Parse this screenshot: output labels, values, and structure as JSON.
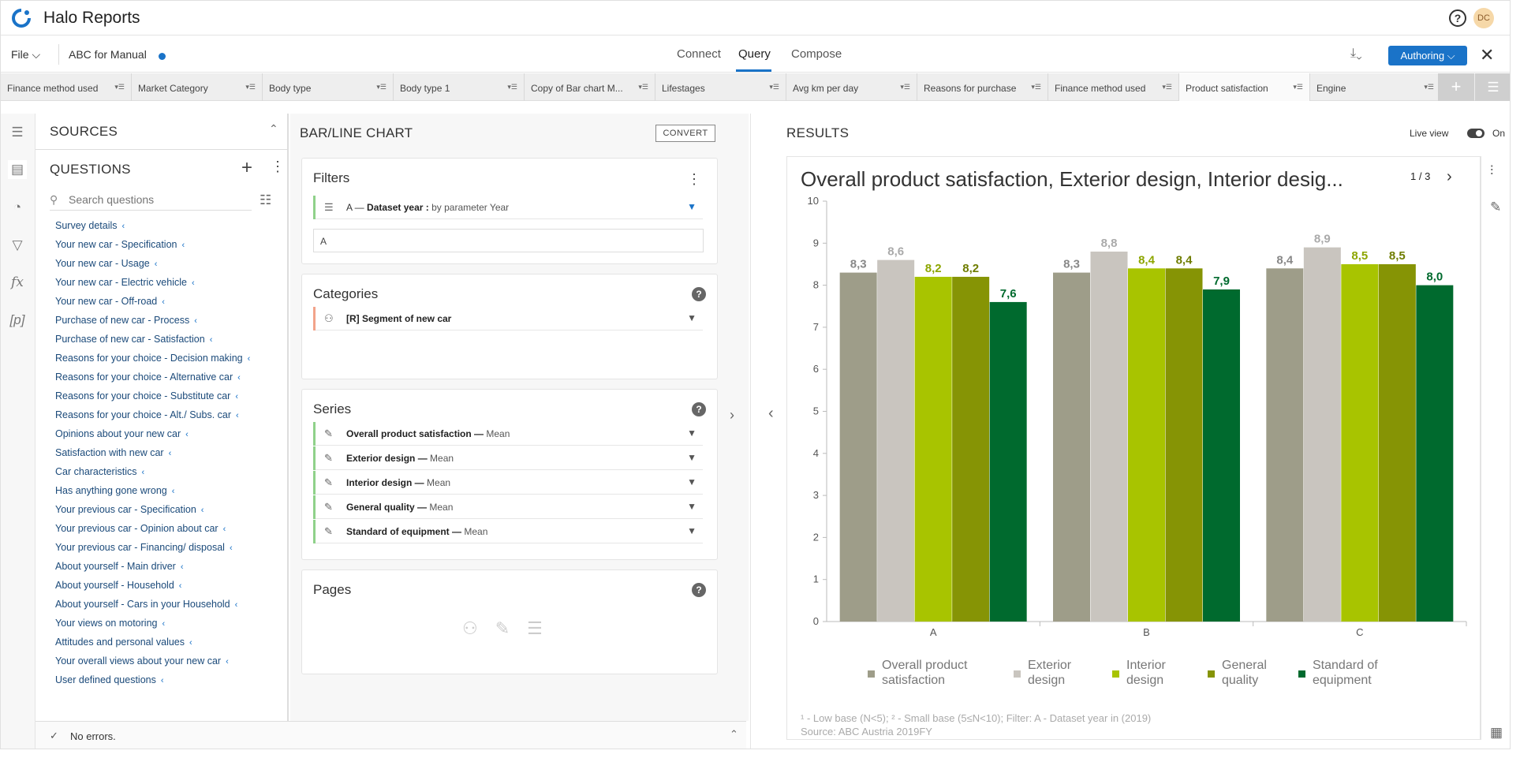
{
  "app": {
    "title": "Halo Reports",
    "avatar_initials": "DC",
    "help": "?"
  },
  "menubar": {
    "file": "File ⌵",
    "report_name": "ABC for Manual",
    "tabs": [
      "Connect",
      "Query",
      "Compose"
    ],
    "active_tab": "Query",
    "authoring": "Authoring ⌵",
    "close": "✕"
  },
  "question_tabs": [
    "Finance method used",
    "Market Category",
    "Body type",
    "Body type 1",
    "Copy of Bar chart M...",
    "Lifestages",
    "Avg km per day",
    "Reasons for purchase",
    "Finance method used",
    "Product satisfaction",
    "Engine"
  ],
  "active_question_tab": "Product satisfaction",
  "left_panel": {
    "sources_header": "SOURCES",
    "questions_header": "QUESTIONS",
    "search_placeholder": "Search questions",
    "questions": [
      "Survey details",
      "Your new car - Specification",
      "Your new car - Usage",
      "Your new car - Electric vehicle",
      "Your new car - Off-road",
      "Purchase of new car - Process",
      "Purchase of new car - Satisfaction",
      "Reasons for your choice - Decision making",
      "Reasons for your choice - Alternative car",
      "Reasons for your choice - Substitute car",
      "Reasons for your choice - Alt./ Subs. car",
      "Opinions about your new car",
      "Satisfaction with new car",
      "Car characteristics",
      "Has anything gone wrong",
      "Your previous car - Specification",
      "Your previous car - Opinion about car",
      "Your previous car - Financing/ disposal",
      "About yourself - Main driver",
      "About yourself - Household",
      "About yourself - Cars in your Household",
      "Your views on motoring",
      "Attitudes and personal values",
      "Your overall views about your new car",
      "User defined questions"
    ],
    "status": "No errors."
  },
  "middle_panel": {
    "title": "BAR/LINE CHART",
    "convert": "CONVERT",
    "filters": {
      "title": "Filters",
      "row_prefix": "A  —",
      "row_label": "Dataset year :",
      "row_suffix": "by parameter Year",
      "input_value": "A"
    },
    "categories": {
      "title": "Categories",
      "row": "[R] Segment of new car"
    },
    "series": {
      "title": "Series",
      "rows": [
        {
          "name": "Overall product satisfaction —",
          "measure": "Mean"
        },
        {
          "name": "Exterior design —",
          "measure": "Mean"
        },
        {
          "name": "Interior design —",
          "measure": "Mean"
        },
        {
          "name": "General quality —",
          "measure": "Mean"
        },
        {
          "name": "Standard of equipment —",
          "measure": "Mean"
        }
      ]
    },
    "pages": {
      "title": "Pages"
    }
  },
  "results": {
    "header": "RESULTS",
    "live_view": "Live view",
    "live_on": "On",
    "page_indicator": "1 / 3",
    "footnote": "¹ - Low base (N<5);   ² - Small base (5≤N<10);   Filter: A - Dataset year in (2019)",
    "source": "Source: ABC Austria 2019FY"
  },
  "colors": {
    "accent": "#1a73c8",
    "series": [
      "#9e9d89",
      "#c9c5bf",
      "#a8c400",
      "#869405",
      "#006a2e"
    ],
    "label_colors": [
      "#888888",
      "#aaaaaa",
      "#8da600",
      "#6f7d00",
      "#006a2e"
    ]
  },
  "chart_data": {
    "type": "bar",
    "title": "Overall product satisfaction, Exterior design, Interior desig...",
    "categories": [
      "A",
      "B",
      "C"
    ],
    "ylim": [
      0,
      10
    ],
    "yticks": [
      0,
      1,
      2,
      3,
      4,
      5,
      6,
      7,
      8,
      9,
      10
    ],
    "grid": false,
    "legend_position": "bottom",
    "series": [
      {
        "name": "Overall product satisfaction",
        "legend_lines": [
          "Overall product",
          "satisfaction"
        ],
        "values": [
          8.3,
          8.3,
          8.4
        ],
        "labels": [
          "8,3",
          "8,3",
          "8,4"
        ]
      },
      {
        "name": "Exterior design",
        "legend_lines": [
          "Exterior",
          "design"
        ],
        "values": [
          8.6,
          8.8,
          8.9
        ],
        "labels": [
          "8,6",
          "8,8",
          "8,9"
        ]
      },
      {
        "name": "Interior design",
        "legend_lines": [
          "Interior",
          "design"
        ],
        "values": [
          8.2,
          8.4,
          8.5
        ],
        "labels": [
          "8,2",
          "8,4",
          "8,5"
        ]
      },
      {
        "name": "General quality",
        "legend_lines": [
          "General",
          "quality"
        ],
        "values": [
          8.2,
          8.4,
          8.5
        ],
        "labels": [
          "8,2",
          "8,4",
          "8,5"
        ]
      },
      {
        "name": "Standard of equipment",
        "legend_lines": [
          "Standard of",
          "equipment"
        ],
        "values": [
          7.6,
          7.9,
          8.0
        ],
        "labels": [
          "7,6",
          "7,9",
          "8,0"
        ]
      }
    ]
  }
}
